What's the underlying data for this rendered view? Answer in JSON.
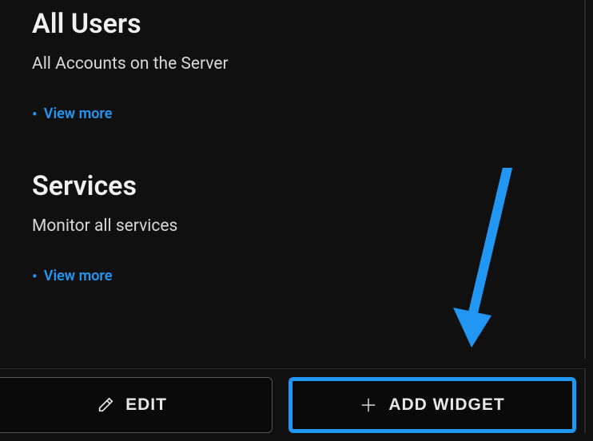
{
  "sections": [
    {
      "title": "All Users",
      "desc": "All Accounts on the Server",
      "view_more": "View more"
    },
    {
      "title": "Services",
      "desc": "Monitor all services",
      "view_more": "View more"
    }
  ],
  "buttons": {
    "edit": "EDIT",
    "add_widget": "ADD WIDGET"
  },
  "colors": {
    "accent": "#2196f3"
  }
}
